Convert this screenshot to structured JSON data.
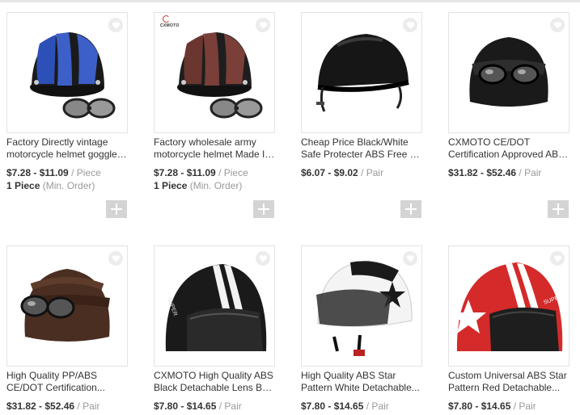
{
  "products": [
    {
      "title_line1": "Factory Directly vintage",
      "title_line2": "motorcycle helmet goggles...",
      "price": "$7.28 - $11.09",
      "unit": "/ Piece",
      "moq_qty": "1 Piece",
      "moq_label": "(Min. Order)",
      "brand_text": "",
      "image": "blue-striped-helmet-with-goggles"
    },
    {
      "title_line1": "Factory wholesale army",
      "title_line2": "motorcycle helmet Made In...",
      "price": "$7.28 - $11.09",
      "unit": "/ Piece",
      "moq_qty": "1 Piece",
      "moq_label": "(Min. Order)",
      "brand_text": "CXMOTO",
      "image": "brown-striped-helmet-with-goggles"
    },
    {
      "title_line1": "Cheap Price Black/White",
      "title_line2": "Safe Protecter ABS Free Si...",
      "price": "$6.07 - $9.02",
      "unit": "/ Pair",
      "moq_qty": "",
      "moq_label": "",
      "brand_text": "",
      "image": "black-half-helmet"
    },
    {
      "title_line1": "CXMOTO CE/DOT",
      "title_line2": "Certification Approved ABS...",
      "price": "$31.82 - $52.46",
      "unit": "/ Pair",
      "moq_qty": "",
      "moq_label": "",
      "brand_text": "",
      "image": "black-german-helmet-goggles"
    },
    {
      "title_line1": "High Quality PP/ABS",
      "title_line2": "CE/DOT Certification...",
      "price": "$31.82 - $52.46",
      "unit": "/ Pair",
      "moq_qty": "",
      "moq_label": "",
      "brand_text": "",
      "image": "brown-german-helmet-goggles"
    },
    {
      "title_line1": "CXMOTO High Quality ABS",
      "title_line2": "Black Detachable Lens Bas...",
      "price": "$7.80 - $14.65",
      "unit": "/ Pair",
      "moq_qty": "",
      "moq_label": "",
      "brand_text": "",
      "image": "black-white-stripe-visor-helmet"
    },
    {
      "title_line1": "High Quality ABS Star",
      "title_line2": "Pattern White Detachable...",
      "price": "$7.80 - $14.65",
      "unit": "/ Pair",
      "moq_qty": "",
      "moq_label": "",
      "brand_text": "",
      "image": "white-star-visor-helmet"
    },
    {
      "title_line1": "Custom Universal ABS Star",
      "title_line2": "Pattern Red Detachable...",
      "price": "$7.80 - $14.65",
      "unit": "/ Pair",
      "moq_qty": "",
      "moq_label": "",
      "brand_text": "",
      "image": "red-star-visor-helmet"
    }
  ],
  "colors": {
    "price_text": "#333333",
    "muted_text": "#999999",
    "add_button": "#d4d4d4",
    "favorite_circle": "#ececec"
  },
  "icons": {
    "favorite": "heart-icon",
    "add": "plus-icon"
  }
}
